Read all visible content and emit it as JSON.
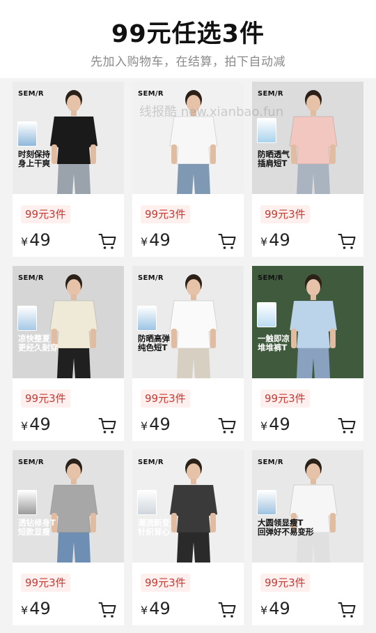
{
  "header": {
    "title": "99元任选3件",
    "subtitle": "先加入购物车，在结算，拍下自动减"
  },
  "watermark": "线报酷 new.xianbao.fun",
  "colors": {
    "accent": "#c43a32",
    "tag_bg": "#fdf0ef"
  },
  "products": [
    {
      "brand": "SEM/R",
      "slogan": "时刻保持\n身上干爽",
      "tag": "99元3件",
      "currency": "¥",
      "price": "49",
      "cart_icon": "shopping-cart-icon",
      "bg": "#ececec",
      "shirt": "#1a1a1a",
      "pants": "#9aa3ab",
      "sloganColor": "#111",
      "sticker": "#8fb8dc"
    },
    {
      "brand": "SEM/R",
      "slogan": "",
      "tag": "99元3件",
      "currency": "¥",
      "price": "49",
      "cart_icon": "shopping-cart-icon",
      "bg": "#f1f1f1",
      "shirt": "#f7f7f7",
      "pants": "#7f98b3",
      "sloganColor": "#111",
      "sticker": ""
    },
    {
      "brand": "SEM/R",
      "slogan": "防晒透气\n插肩短T",
      "tag": "99元3件",
      "currency": "¥",
      "price": "49",
      "cart_icon": "shopping-cart-icon",
      "bg": "#dcdcdc",
      "shirt": "#f2c7c0",
      "pants": "#a9b4c0",
      "sloganColor": "#111",
      "sticker": "#a9d3ec"
    },
    {
      "brand": "SEM/R",
      "slogan": "凉快整夏\n更经久耐穿",
      "tag": "99元3件",
      "currency": "¥",
      "price": "49",
      "cart_icon": "shopping-cart-icon",
      "bg": "#d6d6d6",
      "shirt": "#efead8",
      "pants": "#202020",
      "sloganColor": "#ffffff",
      "sticker": "#a6c8e6"
    },
    {
      "brand": "SEM/R",
      "slogan": "防晒高弹\n纯色短T",
      "tag": "99元3件",
      "currency": "¥",
      "price": "49",
      "cart_icon": "shopping-cart-icon",
      "bg": "#ebebeb",
      "shirt": "#fafafa",
      "pants": "#d6cfc2",
      "sloganColor": "#111",
      "sticker": "#9cc4e4"
    },
    {
      "brand": "SEM/R",
      "slogan": "一触即凉\n堆堆裤T",
      "tag": "99元3件",
      "currency": "¥",
      "price": "49",
      "cart_icon": "shopping-cart-icon",
      "bg": "#3f5a3c",
      "shirt": "#bcd4ea",
      "pants": "#8aa2bf",
      "sloganColor": "#ffffff",
      "sticker": "#bcdcf2"
    },
    {
      "brand": "SEM/R",
      "slogan": "透钻修身T\n短款显瘦",
      "tag": "99元3件",
      "currency": "¥",
      "price": "49",
      "cart_icon": "shopping-cart-icon",
      "bg": "#e2e2e2",
      "shirt": "#a7a7a7",
      "pants": "#6e8fb3",
      "sloganColor": "#ffffff",
      "sticker": "#9a9a9a"
    },
    {
      "brand": "SEM/R",
      "slogan": "潮流新变\n针织背心",
      "tag": "99元3件",
      "currency": "¥",
      "price": "49",
      "cart_icon": "shopping-cart-icon",
      "bg": "#efefef",
      "shirt": "#3a3a3a",
      "pants": "#2a2a2a",
      "sloganColor": "#ffffff",
      "sticker": "#cfd6dc"
    },
    {
      "brand": "SEM/R",
      "slogan": "大圆领显瘦T\n回弹好不易变形",
      "tag": "99元3件",
      "currency": "¥",
      "price": "49",
      "cart_icon": "shopping-cart-icon",
      "bg": "#e8e8e8",
      "shirt": "#f6f6f6",
      "pants": "#e0e0e0",
      "sloganColor": "#111",
      "sticker": "#9fc3e0"
    }
  ]
}
